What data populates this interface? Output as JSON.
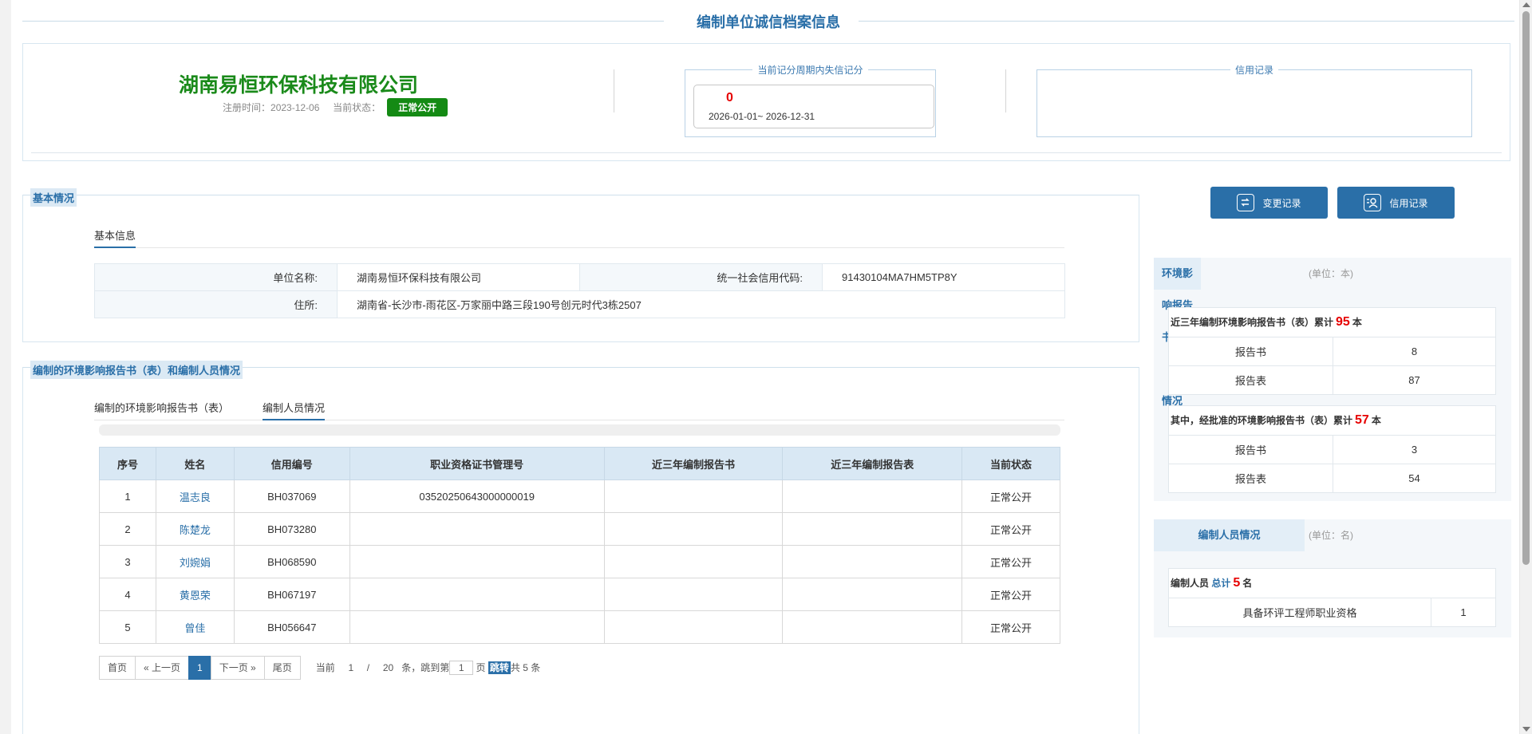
{
  "page": {
    "title": "编制单位诚信档案信息"
  },
  "company": {
    "name": "湖南易恒环保科技有限公司",
    "reg_label": "注册时间：",
    "reg_date": "2023-12-06",
    "status_label": "当前状态：",
    "status": "正常公开"
  },
  "score": {
    "legend": "当前记分周期内失信记分",
    "value": "0",
    "period": "2026-01-01~ 2026-12-31"
  },
  "credit_box": {
    "legend": "信用记录"
  },
  "basic": {
    "section_title": "基本情况",
    "tab": "基本信息",
    "unit_name_label": "单位名称:",
    "unit_name": "湖南易恒环保科技有限公司",
    "credit_code_label": "统一社会信用代码:",
    "credit_code": "91430104MA7HM5TP8Y",
    "address_label": "住所:",
    "address": "湖南省-长沙市-雨花区-万家丽中路三段190号创元时代3栋2507"
  },
  "reports": {
    "section_title": "编制的环境影响报告书（表）和编制人员情况",
    "tabs": [
      "编制的环境影响报告书（表）",
      "编制人员情况"
    ],
    "columns": [
      "序号",
      "姓名",
      "信用编号",
      "职业资格证书管理号",
      "近三年编制报告书",
      "近三年编制报告表",
      "当前状态"
    ],
    "rows": [
      {
        "no": "1",
        "name": "温志良",
        "code": "BH037069",
        "cert": "03520250643000000019",
        "books": "",
        "forms": "",
        "status": "正常公开"
      },
      {
        "no": "2",
        "name": "陈楚龙",
        "code": "BH073280",
        "cert": "",
        "books": "",
        "forms": "",
        "status": "正常公开"
      },
      {
        "no": "3",
        "name": "刘婉娟",
        "code": "BH068590",
        "cert": "",
        "books": "",
        "forms": "",
        "status": "正常公开"
      },
      {
        "no": "4",
        "name": "黄恩荣",
        "code": "BH067197",
        "cert": "",
        "books": "",
        "forms": "",
        "status": "正常公开"
      },
      {
        "no": "5",
        "name": "曾佳",
        "code": "BH056647",
        "cert": "",
        "books": "",
        "forms": "",
        "status": "正常公开"
      }
    ]
  },
  "pager": {
    "first": "首页",
    "prev": "« 上一页",
    "current": "1",
    "next": "下一页 »",
    "last": "尾页",
    "current_label": "当前",
    "page": "1",
    "sep": "/",
    "per_page": "20",
    "jump_label": "条，跳到第",
    "page_input": "1",
    "page_unit": "页",
    "go": "跳转",
    "total": "共 5 条"
  },
  "actions": {
    "change_log": "变更记录",
    "credit_log": "信用记录"
  },
  "eia_summary": {
    "title": "环境影响报告书（表）情况",
    "unit": "(单位：本)",
    "recent_prefix": "近三年编制环境影响报告书（表）累计",
    "recent_total": "95",
    "recent_suffix": "本",
    "recent_rows": [
      {
        "label": "报告书",
        "value": "8"
      },
      {
        "label": "报告表",
        "value": "87"
      }
    ],
    "approved_prefix": "其中，经批准的环境影响报告书（表）累计",
    "approved_total": "57",
    "approved_suffix": "本",
    "approved_rows": [
      {
        "label": "报告书",
        "value": "3"
      },
      {
        "label": "报告表",
        "value": "54"
      }
    ]
  },
  "staff_summary": {
    "title": "编制人员情况",
    "unit": "(单位：名)",
    "prefix": "编制人员",
    "total_label": "总计",
    "total": "5",
    "suffix": "名",
    "qual_label": "具备环评工程师职业资格",
    "qual_value": "1"
  },
  "colors": {
    "accent": "#2a6fa8",
    "company_green": "#1a8a1a",
    "status_green": "#148a14",
    "highlight_red": "#e60000"
  }
}
